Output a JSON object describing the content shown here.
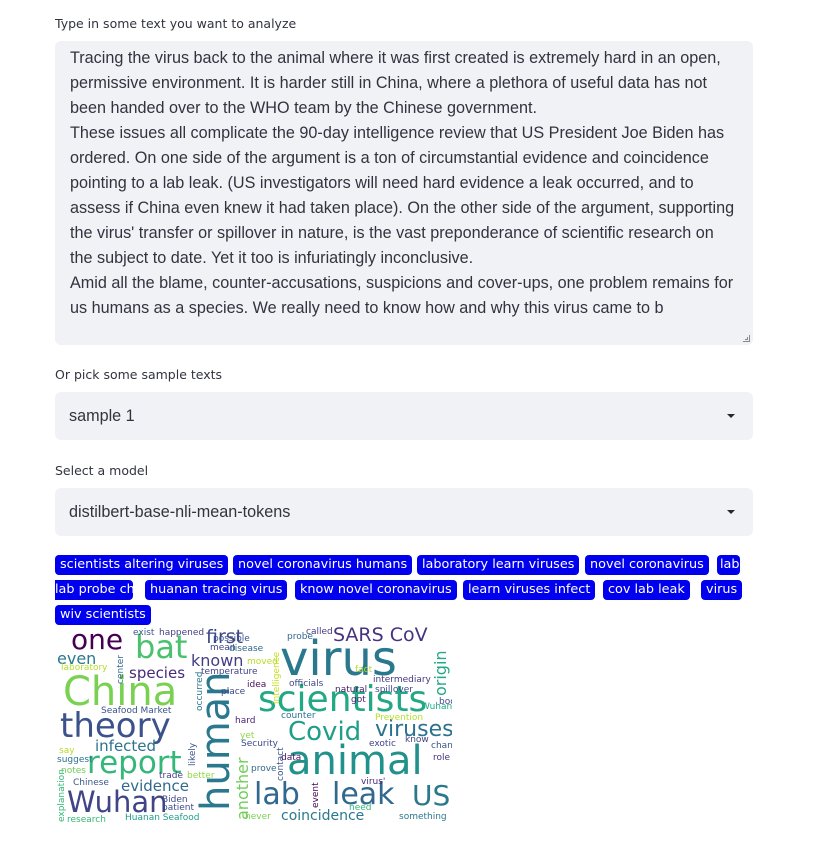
{
  "text_input": {
    "label": "Type in some text you want to analyze",
    "value": "Tracing the virus back to the animal where it was first created is extremely hard in an open, permissive environment. It is harder still in China, where a plethora of useful data has not been handed over to the WHO team by the Chinese government.\nThese issues all complicate the 90-day intelligence review that US President Joe Biden has ordered. On one side of the argument is a ton of circumstantial evidence and coincidence pointing to a lab leak. (US investigators will need hard evidence a leak occurred, and to assess if China even knew it had taken place). On the other side of the argument, supporting the virus' transfer or spillover in nature, is the vast preponderance of scientific research on the subject to date. Yet it too is infuriatingly inconclusive.\nAmid all the blame, counter-accusations, suspicions and cover-ups, one problem remains for us humans as a species. We really need to know how and why this virus came to b"
  },
  "sample_select": {
    "label": "Or pick some sample texts",
    "value": "sample 1"
  },
  "model_select": {
    "label": "Select a model",
    "value": "distilbert-base-nli-mean-tokens"
  },
  "keywords": [
    "scientists altering viruses",
    "novel coronavirus humans",
    "laboratory learn viruses",
    "novel coronavirus",
    "lab probe china",
    "huanan tracing virus",
    "know novel coronavirus",
    "learn viruses infect",
    "cov lab leak",
    "virus",
    "wiv scientists"
  ],
  "wordcloud": {
    "words": [
      {
        "text": "virus",
        "color": "#2a788e"
      },
      {
        "text": "China",
        "color": "#7ad151"
      },
      {
        "text": "scientists",
        "color": "#22a884"
      },
      {
        "text": "theory",
        "color": "#3b528b"
      },
      {
        "text": "animal",
        "color": "#21918c"
      },
      {
        "text": "human",
        "color": "#2a788e"
      },
      {
        "text": "report",
        "color": "#35b779"
      },
      {
        "text": "Wuhan",
        "color": "#414487"
      },
      {
        "text": "lab",
        "color": "#31688e"
      },
      {
        "text": "leak",
        "color": "#31688e"
      },
      {
        "text": "US",
        "color": "#2a788e"
      },
      {
        "text": "bat",
        "color": "#4ac16d"
      },
      {
        "text": "one",
        "color": "#440154"
      },
      {
        "text": "Covid",
        "color": "#1f9e89"
      },
      {
        "text": "viruses",
        "color": "#2c728e"
      },
      {
        "text": "SARS CoV",
        "color": "#46327e"
      },
      {
        "text": "first",
        "color": "#3e4989"
      },
      {
        "text": "even",
        "color": "#2a788e"
      },
      {
        "text": "known",
        "color": "#433e85"
      },
      {
        "text": "species",
        "color": "#482878"
      },
      {
        "text": "origin",
        "color": "#22a884"
      },
      {
        "text": "infected",
        "color": "#2c728e"
      },
      {
        "text": "evidence",
        "color": "#31688e"
      },
      {
        "text": "another",
        "color": "#6ece58"
      },
      {
        "text": "coincidence",
        "color": "#2a788e"
      },
      {
        "text": "Seafood Market",
        "color": "#3b528b"
      },
      {
        "text": "Huanan Seafood",
        "color": "#1f9e89"
      },
      {
        "text": "temperature",
        "color": "#414487"
      },
      {
        "text": "intermediary",
        "color": "#443983"
      },
      {
        "text": "officials",
        "color": "#3e4989"
      },
      {
        "text": "disease",
        "color": "#31688e"
      },
      {
        "text": "probe",
        "color": "#31688e"
      },
      {
        "text": "occurred",
        "color": "#2a788e"
      },
      {
        "text": "likely",
        "color": "#3b528b"
      },
      {
        "text": "exotic",
        "color": "#414487"
      },
      {
        "text": "laboratory",
        "color": "#b5de2b"
      },
      {
        "text": "Chinese",
        "color": "#38588c"
      },
      {
        "text": "research",
        "color": "#35b779"
      },
      {
        "text": "hard",
        "color": "#482475"
      },
      {
        "text": "idea",
        "color": "#471063"
      },
      {
        "text": "yet",
        "color": "#90d743"
      },
      {
        "text": "counter",
        "color": "#2c728e"
      },
      {
        "text": "Biden",
        "color": "#3e4989"
      },
      {
        "text": "contact",
        "color": "#3b528b"
      },
      {
        "text": "event",
        "color": "#440154"
      },
      {
        "text": "say",
        "color": "#b5de2b"
      },
      {
        "text": "trade",
        "color": "#414487"
      },
      {
        "text": "patient",
        "color": "#3e4989"
      },
      {
        "text": "intelligence",
        "color": "#c8e020"
      },
      {
        "text": "Prevention",
        "color": "#b5de2b"
      },
      {
        "text": "prove",
        "color": "#31688e"
      },
      {
        "text": "something",
        "color": "#2a788e"
      },
      {
        "text": "never",
        "color": "#7ad151"
      },
      {
        "text": "virus'",
        "color": "#482878"
      },
      {
        "text": "role",
        "color": "#46327e"
      },
      {
        "text": "spillover",
        "color": "#3e4989"
      },
      {
        "text": "happened",
        "color": "#433e85"
      },
      {
        "text": "possible",
        "color": "#3b528b"
      },
      {
        "text": "mean",
        "color": "#3e4989"
      },
      {
        "text": "called",
        "color": "#443983"
      },
      {
        "text": "natural",
        "color": "#481b6d"
      },
      {
        "text": "notes",
        "color": "#6ece58"
      },
      {
        "text": "suggest",
        "color": "#2c728e"
      },
      {
        "text": "center",
        "color": "#31688e"
      },
      {
        "text": "exist",
        "color": "#38588c"
      },
      {
        "text": "moved",
        "color": "#b5de2b"
      },
      {
        "text": "fact",
        "color": "#b5de2b"
      },
      {
        "text": "Security",
        "color": "#3e4989"
      },
      {
        "text": "explanation",
        "color": "#35b779"
      },
      {
        "text": "got",
        "color": "#482475"
      },
      {
        "text": "place",
        "color": "#3e4989"
      },
      {
        "text": "need",
        "color": "#35b779"
      },
      {
        "text": "better",
        "color": "#90d743"
      },
      {
        "text": "Wuhan",
        "color": "#22a884"
      },
      {
        "text": "know",
        "color": "#414487"
      },
      {
        "text": "change",
        "color": "#3b528b"
      },
      {
        "text": "data",
        "color": "#471063"
      },
      {
        "text": "body",
        "color": "#3e4989"
      }
    ]
  }
}
